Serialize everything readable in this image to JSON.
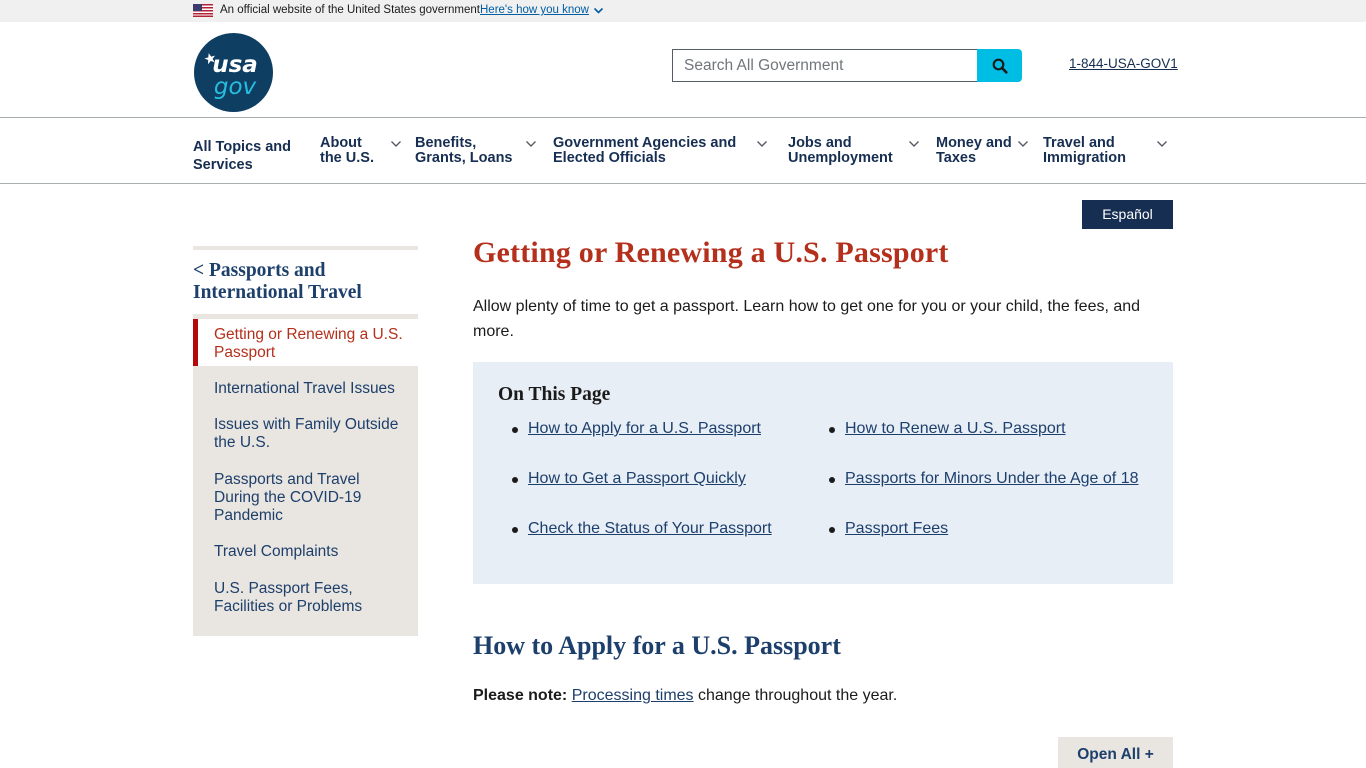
{
  "gov_banner": {
    "official_text": "An official website of the United States government",
    "how_you_know_link": "Here's how you know",
    "icons": {
      "flag": "us-flag-icon",
      "expand": "chevron-down-icon"
    }
  },
  "header": {
    "logo": {
      "line1": "usa",
      "line2": "gov"
    },
    "search": {
      "placeholder": "Search All Government",
      "value": "",
      "button_icon": "search-icon"
    },
    "phone_link": "1-844-USA-GOV1"
  },
  "nav": {
    "items": [
      {
        "label_line1": "All Topics and",
        "label_line2": "Services",
        "has_dropdown": false
      },
      {
        "label_line1": "About",
        "label_line2": "the U.S.",
        "has_dropdown": true
      },
      {
        "label_line1": "Benefits,",
        "label_line2": "Grants, Loans",
        "has_dropdown": true
      },
      {
        "label_line1": "Government Agencies and",
        "label_line2": "Elected Officials",
        "has_dropdown": true
      },
      {
        "label_line1": "Jobs and",
        "label_line2": "Unemployment",
        "has_dropdown": true
      },
      {
        "label_line1": "Money and",
        "label_line2": "Taxes",
        "has_dropdown": true
      },
      {
        "label_line1": "Travel and",
        "label_line2": "Immigration",
        "has_dropdown": true
      }
    ]
  },
  "language_toggle": "Español",
  "sidebar": {
    "parent_link": "< Passports and International Travel",
    "current": "Getting or Renewing a U.S. Passport",
    "items": [
      "International Travel Issues",
      "Issues with Family Outside the U.S.",
      "Passports and Travel During the COVID-19 Pandemic",
      "Travel Complaints",
      "U.S. Passport Fees, Facilities or Problems"
    ]
  },
  "main": {
    "title": "Getting or Renewing a U.S. Passport",
    "intro": "Allow plenty of time to get a passport. Learn how to get one for you or your child, the fees, and more.",
    "on_this_page": {
      "title": "On This Page",
      "links": [
        "How to Apply for a U.S. Passport",
        "How to Get a Passport Quickly",
        "Check the Status of Your Passport",
        "How to Renew a U.S. Passport",
        "Passports for Minors Under the Age of 18",
        "Passport Fees"
      ]
    },
    "section_title": "How to Apply for a U.S. Passport",
    "note_label": "Please note:",
    "note_link": "Processing times",
    "note_rest": " change throughout the year.",
    "open_all_button": "Open All +"
  },
  "colors": {
    "navy": "#162e51",
    "title_red": "#b5301c",
    "accent_red": "#b50909",
    "search_cyan": "#00bde3",
    "otp_bg": "#e7eef6",
    "sidebar_bg": "#e9e5e0"
  }
}
